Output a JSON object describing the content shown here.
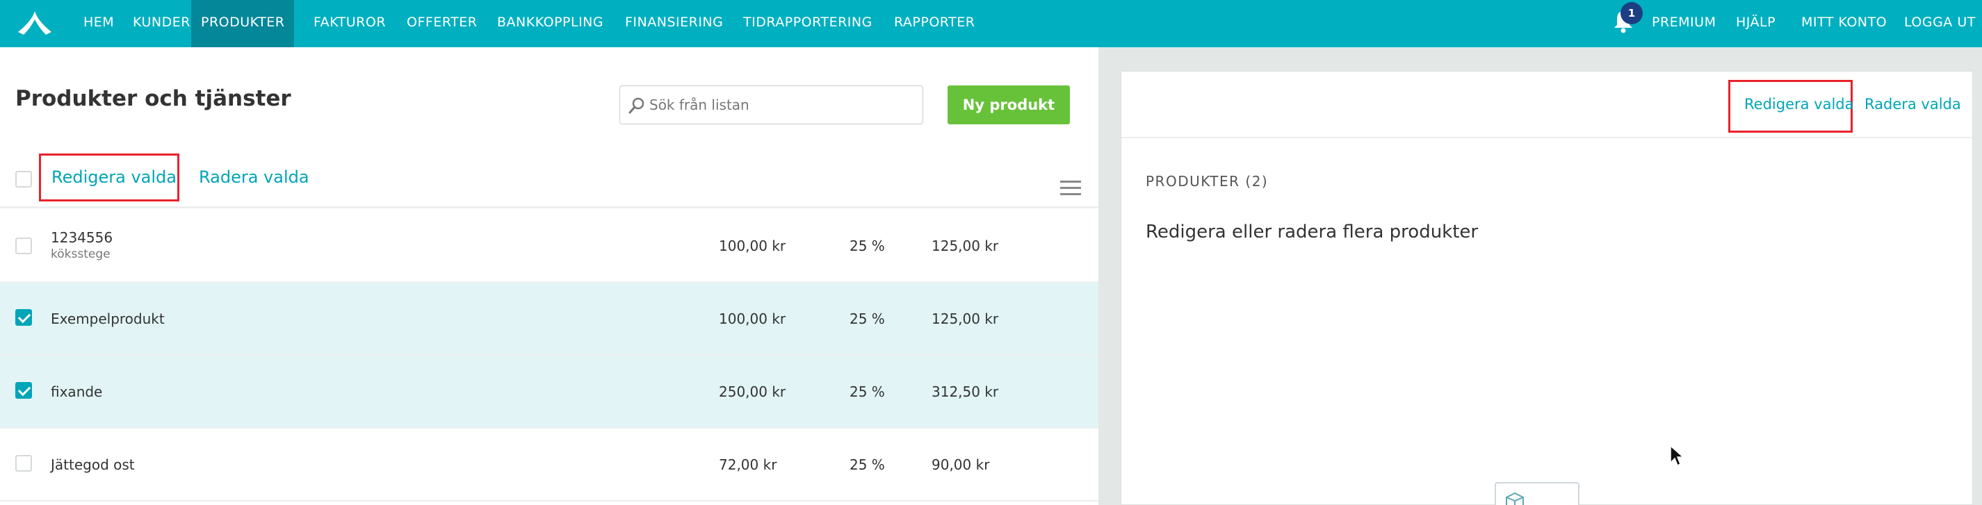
{
  "nav": {
    "items": [
      "HEM",
      "KUNDER",
      "PRODUKTER",
      "FAKTUROR",
      "OFFERTER",
      "BANKKOPPLING",
      "FINANSIERING",
      "TIDRAPPORTERING",
      "RAPPORTER"
    ],
    "active": "PRODUKTER",
    "notification_count": "1",
    "right_items": [
      "PREMIUM",
      "HJÄLP",
      "MITT KONTO",
      "LOGGA UT"
    ],
    "icons": {
      "logo": "logo-icon",
      "notifications": "bell-icon"
    }
  },
  "list": {
    "title": "Produkter och tjänster",
    "search_placeholder": "Sök från listan",
    "new_button": "Ny produkt",
    "bulk_edit": "Redigera valda",
    "bulk_delete": "Radera valda",
    "rows": [
      {
        "name": "1234556",
        "subtitle": "köksstege",
        "price": "100,00 kr",
        "vat": "25 %",
        "total": "125,00 kr",
        "checked": false
      },
      {
        "name": "Exempelprodukt",
        "subtitle": "",
        "price": "100,00 kr",
        "vat": "25 %",
        "total": "125,00 kr",
        "checked": true
      },
      {
        "name": "fixande",
        "subtitle": "",
        "price": "250,00 kr",
        "vat": "25 %",
        "total": "312,50 kr",
        "checked": true
      },
      {
        "name": "Jättegod ost",
        "subtitle": "",
        "price": "72,00 kr",
        "vat": "25 %",
        "total": "90,00 kr",
        "checked": false
      }
    ]
  },
  "detail": {
    "edit_selected": "Redigera valda",
    "delete_selected": "Radera valda",
    "section_label": "PRODUKTER (2)",
    "heading": "Redigera eller radera flera produkter"
  },
  "colors": {
    "topbar": "#00b0c0",
    "active_nav": "#05879a",
    "accent": "#00a5b8",
    "new_button": "#67c23a",
    "highlight": "#e8232a",
    "badge": "#1c3e82",
    "selected_row": "#e2f4f6"
  }
}
